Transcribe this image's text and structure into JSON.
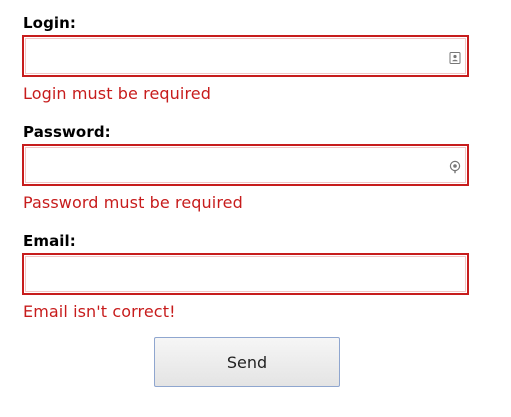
{
  "form": {
    "login": {
      "label": "Login:",
      "value": "",
      "error": "Login must be required",
      "icon": "contact-card-icon"
    },
    "password": {
      "label": "Password:",
      "value": "",
      "error": "Password must be required",
      "icon": "key-icon"
    },
    "email": {
      "label": "Email:",
      "value": "",
      "error": "Email isn't correct!"
    },
    "send_label": "Send"
  },
  "colors": {
    "error": "#c71c1c",
    "button_border": "#8fa6cf"
  }
}
